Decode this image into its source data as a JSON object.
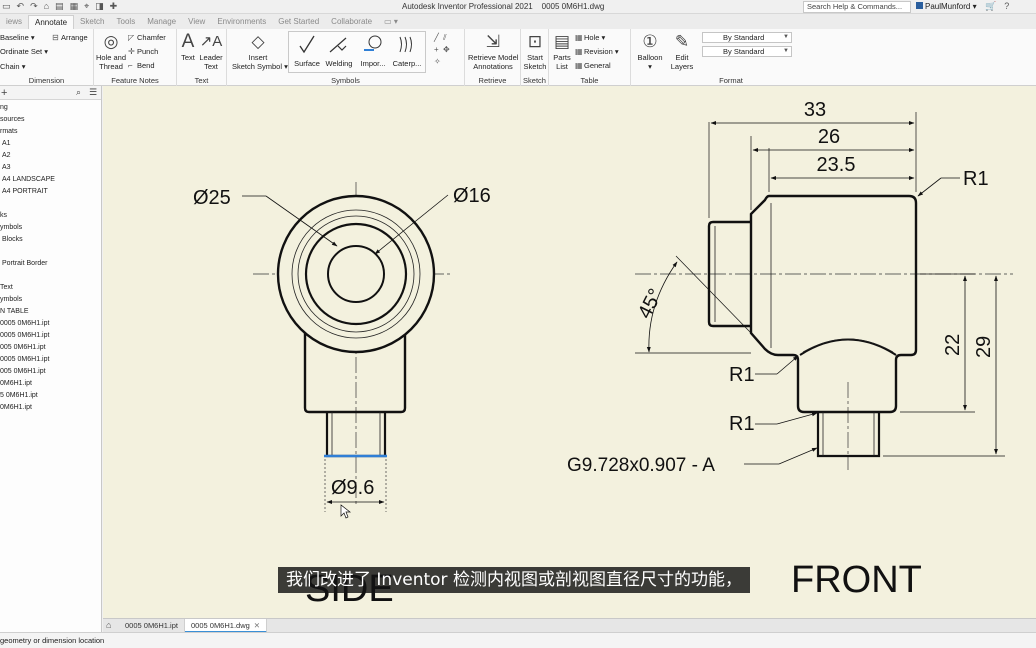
{
  "titlebar": {
    "app_title": "Autodesk Inventor Professional 2021",
    "document_title": "0005 0M6H1.dwg",
    "search_placeholder": "Search Help & Commands...",
    "user": "PaulMunford"
  },
  "tabs": [
    {
      "label": "iews"
    },
    {
      "label": "Annotate",
      "active": true
    },
    {
      "label": "Sketch"
    },
    {
      "label": "Tools"
    },
    {
      "label": "Manage"
    },
    {
      "label": "View"
    },
    {
      "label": "Environments"
    },
    {
      "label": "Get Started"
    },
    {
      "label": "Collaborate"
    }
  ],
  "ribbon": {
    "dimension": {
      "baseline": "Baseline",
      "ordinate_set": "Ordinate Set",
      "chain": "Chain",
      "arrange": "Arrange",
      "title": "Dimension"
    },
    "feature_notes": {
      "hole_and_thread_1": "Hole and",
      "hole_and_thread_2": "Thread",
      "chamfer": "Chamfer",
      "punch": "Punch",
      "bend": "Bend",
      "title": "Feature Notes"
    },
    "text": {
      "text": "Text",
      "leader_text_1": "Leader",
      "leader_text_2": "Text",
      "title": "Text"
    },
    "symbols": {
      "insert_1": "Insert",
      "insert_2": "Sketch Symbol",
      "surface": "Surface",
      "welding": "Welding",
      "import": "Impor...",
      "caterpillar": "Caterp...",
      "title": "Symbols"
    },
    "retrieve": {
      "label_1": "Retrieve Model",
      "label_2": "Annotations",
      "title": "Retrieve"
    },
    "sketch": {
      "label_1": "Start",
      "label_2": "Sketch",
      "title": "Sketch"
    },
    "table": {
      "parts_1": "Parts",
      "parts_2": "List",
      "hole": "Hole",
      "revision": "Revision",
      "general": "General",
      "title": "Table"
    },
    "balloon": {
      "label": "Balloon"
    },
    "edit_layers": {
      "label_1": "Edit",
      "label_2": "Layers"
    },
    "format": {
      "style_1": "By Standard",
      "style_2": "By Standard",
      "title": "Format"
    }
  },
  "browser": {
    "items": [
      "ng",
      "sources",
      "rmats",
      "A1",
      "A2",
      "A3",
      "A4 LANDSCAPE",
      "A4 PORTRAIT",
      "ks",
      "ymbols",
      "Blocks",
      "Portrait Border",
      "Text",
      "ymbols",
      "N TABLE",
      "0005 0M6H1.ipt",
      "0005 0M6H1.ipt",
      "005 0M6H1.ipt",
      "0005 0M6H1.ipt",
      "005 0M6H1.ipt",
      "0M6H1.ipt",
      "5 0M6H1.ipt",
      "0M6H1.ipt"
    ]
  },
  "drawing": {
    "side": {
      "dia_outer": "Ø25",
      "dia_inner": "Ø16",
      "dia_shaft": "Ø9.6",
      "view_label": "SIDE"
    },
    "front": {
      "dim_33": "33",
      "dim_26": "26",
      "dim_23_5": "23.5",
      "radius_top": "R1",
      "angle": "45°",
      "radius_mid": "R1",
      "radius_low": "R1",
      "dim_22": "22",
      "dim_29": "29",
      "thread_note": "G9.728x0.907 - A",
      "view_label": "FRONT"
    },
    "highlight_color": "#2f7fd6",
    "paper_color": "#f3f1de"
  },
  "subtitle": "我们改进了 Inventor 检测内视图或剖视图直径尺寸的功能，",
  "doc_tabs": [
    {
      "label": "0005 0M6H1.ipt"
    },
    {
      "label": "0005 0M6H1.dwg",
      "active": true
    }
  ],
  "status": "geometry or dimension location"
}
